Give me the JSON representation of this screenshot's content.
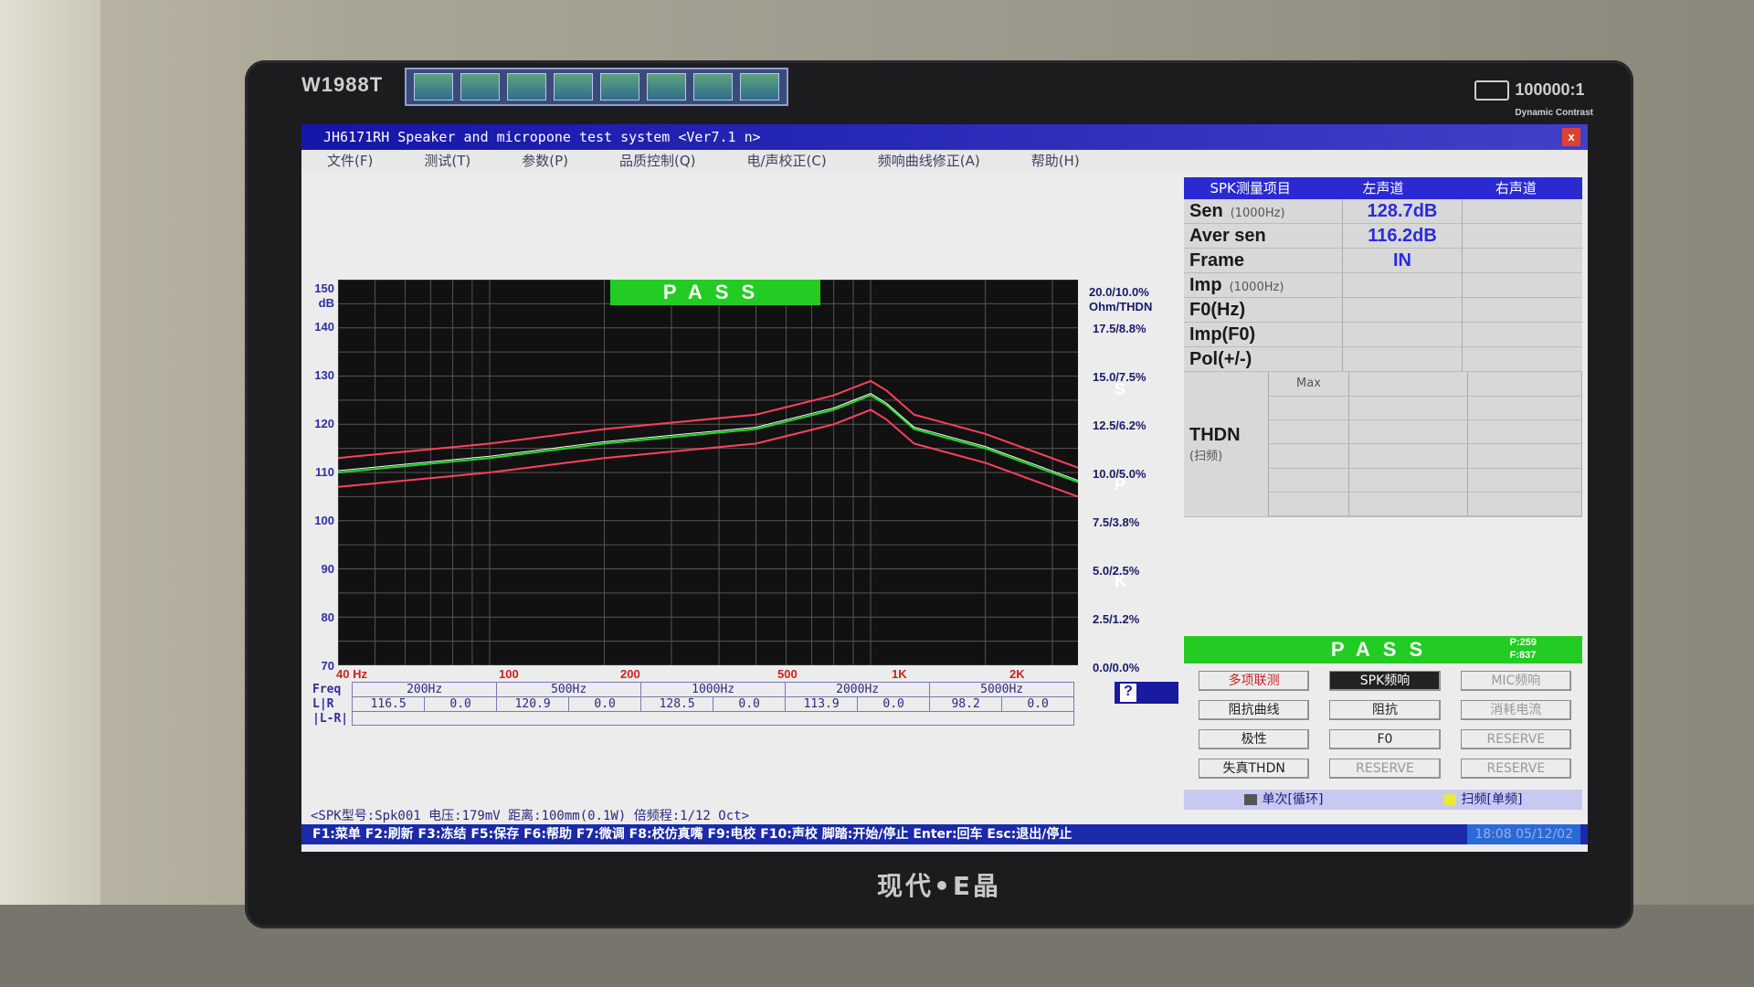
{
  "monitor": {
    "model": "W1988T",
    "contrast": "100000:1",
    "contrast_sub": "Dynamic Contrast",
    "logo": "现代•E晶"
  },
  "window": {
    "title": "JH6171RH Speaker and micropone test system <Ver7.1 n>",
    "close_label": "x"
  },
  "menu": [
    "文件(F)",
    "测试(T)",
    "参数(P)",
    "品质控制(Q)",
    "电/声校正(C)",
    "频响曲线修正(A)",
    "帮助(H)"
  ],
  "chart": {
    "pass_label": "PASS",
    "y_unit": "dB",
    "y_ticks": [
      "150",
      "140",
      "130",
      "120",
      "110",
      "100",
      "90",
      "80",
      "70"
    ],
    "right_ticks": [
      "20.0/10.0%",
      "17.5/8.8%",
      "15.0/7.5%",
      "12.5/6.2%",
      "10.0/5.0%",
      "7.5/3.8%",
      "5.0/2.5%",
      "2.5/1.2%",
      "0.0/0.0%"
    ],
    "right_unit": "Ohm/THDN",
    "x_ticks": [
      "40 Hz",
      "100",
      "200",
      "500",
      "1K",
      "2K"
    ],
    "side_letters": [
      "S",
      "P",
      "K"
    ],
    "colors": {
      "grid_bg": "#111111",
      "curve": "#22dd22",
      "limits": "#ff4060",
      "white": "#ffffff"
    }
  },
  "chart_data": {
    "type": "line",
    "title": "",
    "xlabel": "Hz",
    "ylabel": "dB",
    "x_scale": "log",
    "xlim": [
      40,
      3500
    ],
    "ylim": [
      70,
      150
    ],
    "grid": true,
    "series": [
      {
        "x": [
          40,
          100,
          200,
          500,
          800,
          1000,
          1100,
          1300,
          2000,
          3500
        ],
        "values": [
          110,
          113,
          116,
          119,
          123,
          126,
          124,
          119,
          115,
          108
        ]
      },
      {
        "x": [
          40,
          100,
          200,
          500,
          800,
          1000,
          1100,
          1300,
          2000,
          3500
        ],
        "values": [
          113,
          116,
          119,
          122,
          126,
          129,
          127,
          122,
          118,
          111
        ]
      },
      {
        "x": [
          40,
          100,
          200,
          500,
          800,
          1000,
          1100,
          1300,
          2000,
          3500
        ],
        "values": [
          107,
          110,
          113,
          116,
          120,
          123,
          121,
          116,
          112,
          105
        ]
      }
    ]
  },
  "freq_table": {
    "row_labels": [
      "Freq",
      "L|R",
      "|L-R|"
    ],
    "columns": [
      {
        "freq": "200Hz",
        "l": "116.5",
        "r": "0.0"
      },
      {
        "freq": "500Hz",
        "l": "120.9",
        "r": "0.0"
      },
      {
        "freq": "1000Hz",
        "l": "128.5",
        "r": "0.0"
      },
      {
        "freq": "2000Hz",
        "l": "113.9",
        "r": "0.0"
      },
      {
        "freq": "5000Hz",
        "l": "98.2",
        "r": "0.0"
      }
    ],
    "help_button": "?"
  },
  "results": {
    "headers": [
      "SPK测量项目",
      "左声道",
      "右声道"
    ],
    "rows": [
      {
        "label": "Sen",
        "sub": "(1000Hz)",
        "left": "128.7dB"
      },
      {
        "label": "Aver sen",
        "sub": "",
        "left": "116.2dB"
      },
      {
        "label": "Frame",
        "sub": "",
        "left": "IN"
      },
      {
        "label": "Imp",
        "sub": "(1000Hz)",
        "left": ""
      },
      {
        "label": "F0(Hz)",
        "sub": "",
        "left": ""
      },
      {
        "label": "Imp(F0)",
        "sub": "",
        "left": ""
      },
      {
        "label": "Pol(+/-)",
        "sub": "",
        "left": ""
      }
    ],
    "thdn_label": "THDN",
    "thdn_sub": "(扫频)",
    "thdn_max": "Max"
  },
  "pass_bar": {
    "label": "PASS",
    "p": "P:259",
    "f": "F:837"
  },
  "buttons": [
    {
      "label": "多项联测",
      "style": "red"
    },
    {
      "label": "SPK频响",
      "style": "dark"
    },
    {
      "label": "MIC频响",
      "style": "dim"
    },
    {
      "label": "阻抗曲线",
      "style": ""
    },
    {
      "label": "阻抗",
      "style": ""
    },
    {
      "label": "消耗电流",
      "style": "dim"
    },
    {
      "label": "极性",
      "style": ""
    },
    {
      "label": "F0",
      "style": ""
    },
    {
      "label": "RESERVE",
      "style": "dim"
    },
    {
      "label": "失真THDN",
      "style": ""
    },
    {
      "label": "RESERVE",
      "style": "dim"
    },
    {
      "label": "RESERVE",
      "style": "dim"
    }
  ],
  "mode": {
    "single": "单次[循环]",
    "sweep": "扫频[单频]"
  },
  "status": {
    "text": "<SPK型号:Spk001  电压:179mV  距离:100mm(0.1W)  倍频程:1/12 Oct>"
  },
  "fkeys": {
    "text": "F1:菜单 F2:刷新 F3:冻结 F5:保存 F6:帮助 F7:微调 F8:校仿真嘴 F9:电校 F10:声校 脚踏:开始/停止 Enter:回车 Esc:退出/停止",
    "clock": "18:08 05/12/02"
  }
}
